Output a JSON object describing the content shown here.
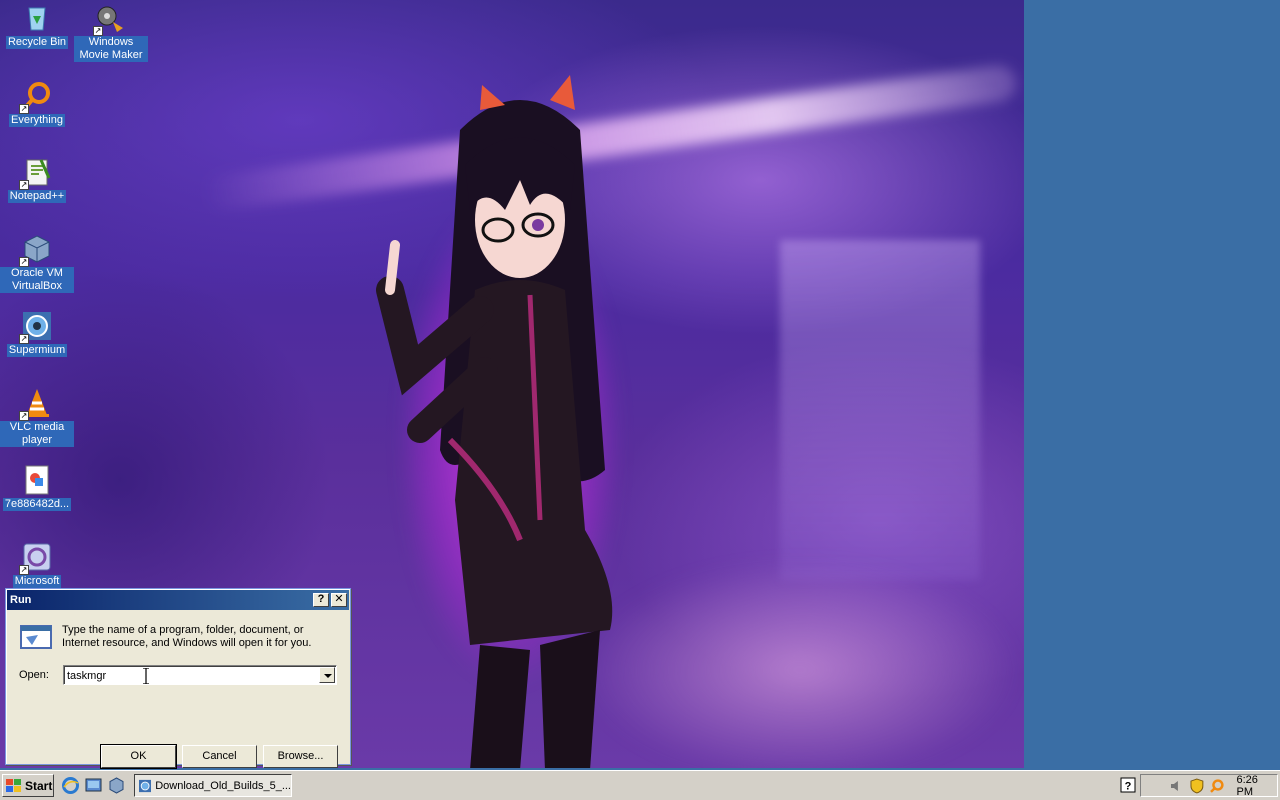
{
  "desktop": {
    "icons": [
      {
        "label": "Recycle Bin"
      },
      {
        "label": "Windows Movie Maker"
      },
      {
        "label": "Everything"
      },
      {
        "label": "Notepad++"
      },
      {
        "label": "Oracle VM VirtualBox"
      },
      {
        "label": "Supermium"
      },
      {
        "label": "VLC media player"
      },
      {
        "label": "7e886482d..."
      },
      {
        "label": "Microsoft"
      }
    ]
  },
  "run_dialog": {
    "title": "Run",
    "help_btn": "?",
    "close_btn": "✕",
    "description": "Type the name of a program, folder, document, or Internet resource, and Windows will open it for you.",
    "open_label": "Open:",
    "open_value": "taskmgr",
    "ok_label": "OK",
    "cancel_label": "Cancel",
    "browse_label": "Browse..."
  },
  "taskbar": {
    "start_label": "Start",
    "task_label": "Download_Old_Builds_5_...",
    "clock": "6:26 PM"
  },
  "colors": {
    "desktop_bg": "#3a6ea5",
    "titlebar_start": "#0a246a",
    "titlebar_end": "#3a6ea5",
    "face": "#d4d0c8"
  }
}
